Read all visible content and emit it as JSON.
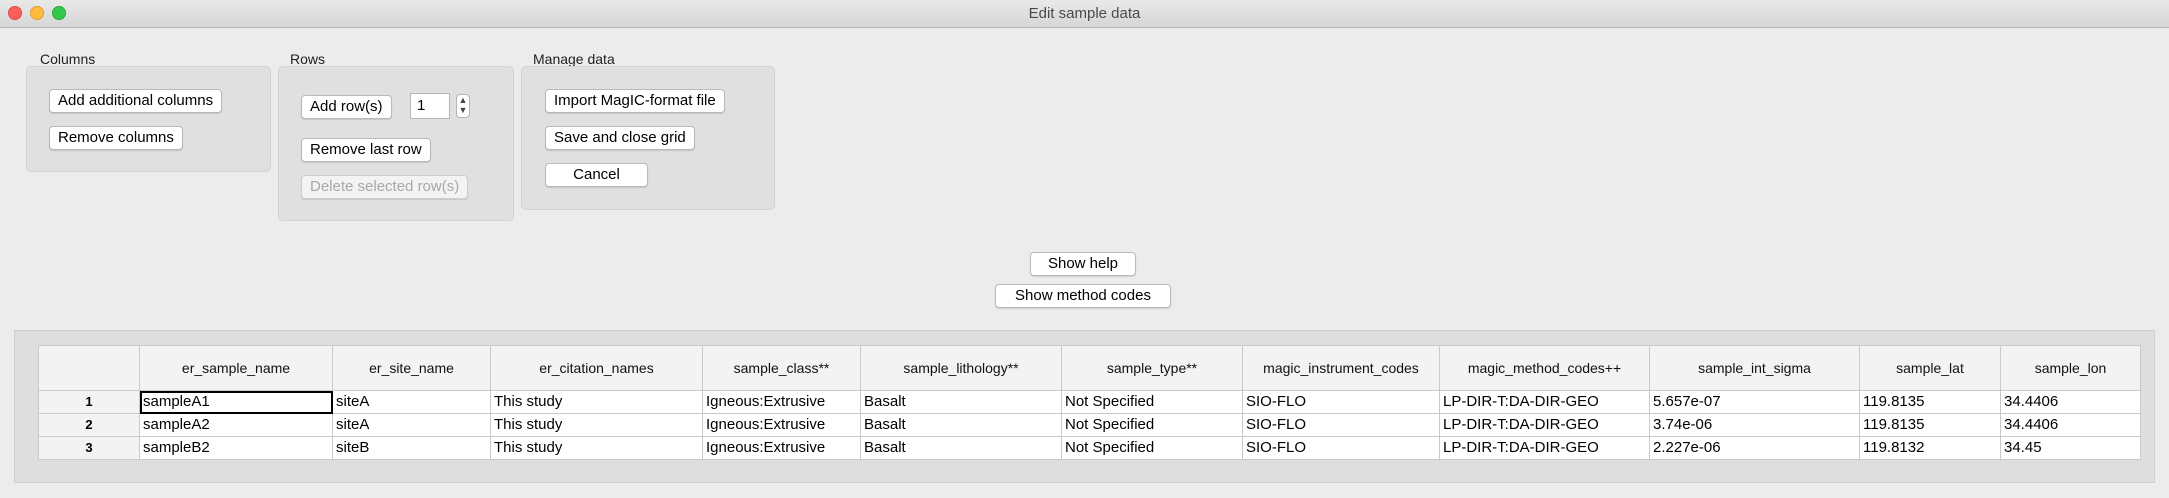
{
  "window": {
    "title": "Edit sample data"
  },
  "columns_group": {
    "label": "Columns",
    "add_columns": "Add additional columns",
    "remove_columns": "Remove columns"
  },
  "rows_group": {
    "label": "Rows",
    "add_rows": "Add row(s)",
    "row_count": "1",
    "remove_last": "Remove last row",
    "delete_selected": "Delete selected row(s)"
  },
  "manage_group": {
    "label": "Manage data",
    "import": "Import MagIC-format file",
    "save_close": "Save and close grid",
    "cancel": "Cancel"
  },
  "help": {
    "show_help": "Show help",
    "show_method_codes": "Show method codes"
  },
  "grid": {
    "headers": [
      "er_sample_name",
      "er_site_name",
      "er_citation_names",
      "sample_class**",
      "sample_lithology**",
      "sample_type**",
      "magic_instrument_codes",
      "magic_method_codes++",
      "sample_int_sigma",
      "sample_lat",
      "sample_lon"
    ],
    "rows": [
      {
        "label": "1",
        "cells": [
          "sampleA1",
          "siteA",
          "This study",
          "Igneous:Extrusive",
          "Basalt",
          "Not Specified",
          "SIO-FLO",
          "LP-DIR-T:DA-DIR-GEO",
          "5.657e-07",
          "119.8135",
          "34.4406"
        ]
      },
      {
        "label": "2",
        "cells": [
          "sampleA2",
          "siteA",
          "This study",
          "Igneous:Extrusive",
          "Basalt",
          "Not Specified",
          "SIO-FLO",
          "LP-DIR-T:DA-DIR-GEO",
          "3.74e-06",
          "119.8135",
          "34.4406"
        ]
      },
      {
        "label": "3",
        "cells": [
          "sampleB2",
          "siteB",
          "This study",
          "Igneous:Extrusive",
          "Basalt",
          "Not Specified",
          "SIO-FLO",
          "LP-DIR-T:DA-DIR-GEO",
          "2.227e-06",
          "119.8132",
          "34.45"
        ]
      }
    ]
  }
}
